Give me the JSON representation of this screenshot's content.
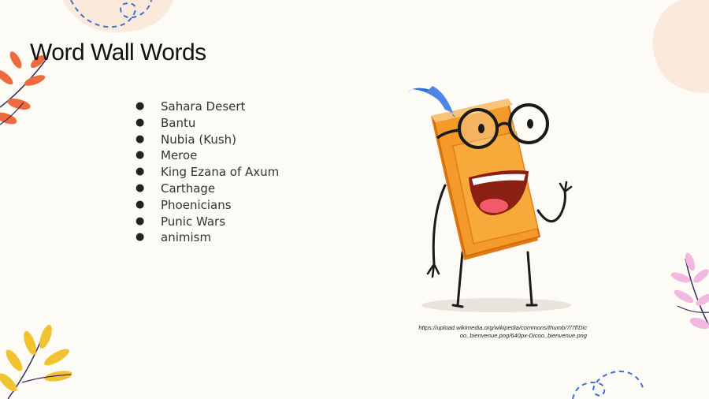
{
  "slide": {
    "title": "Word Wall Words",
    "words": [
      "Sahara Desert",
      "Bantu",
      "Nubia (Kush)",
      "Meroe",
      "King Ezana of Axum",
      "Carthage",
      "Phoenicians",
      "Punic Wars",
      "animism"
    ],
    "bullet": "●",
    "image_caption_line1": "https://upload.wikimedia.org/wikipedia/commons/thumb/7/7f/Dic",
    "image_caption_line2": "oo_bienvenue.png/640px-Dicoo_bienvenue.png"
  },
  "illustration": {
    "subject": "cartoon book mascot with glasses waving",
    "colors": {
      "book_body": "#f39a2a",
      "book_cover_dark": "#e57b14",
      "bookmark": "#2f6fd6",
      "mouth": "#8a1f12",
      "tongue": "#f15a6a",
      "outline": "#1a1a1a"
    }
  },
  "theme": {
    "background": "#fdfbf5",
    "leaf_orange": "#ef6a3c",
    "leaf_yellow": "#f2c230",
    "leaf_pink": "#f3b8e0",
    "dash_blue": "#3d6fd1",
    "blob_peach": "#fbeadb"
  }
}
